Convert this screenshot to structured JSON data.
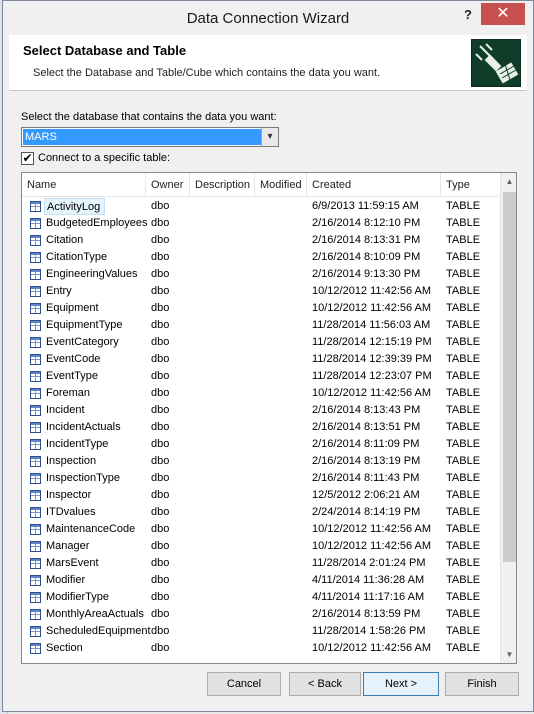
{
  "window": {
    "title": "Data Connection Wizard",
    "help_label": "?",
    "close_label": "✕"
  },
  "header": {
    "title": "Select Database and Table",
    "subtitle": "Select the Database and Table/Cube which contains the data you want."
  },
  "database": {
    "label": "Select the database that contains the data you want:",
    "selected": "MARS",
    "arrow": "▾"
  },
  "connect_specific": {
    "checked": true,
    "check_glyph": "✔",
    "label": "Connect to a specific table:"
  },
  "table": {
    "columns": [
      "Name",
      "Owner",
      "Description",
      "Modified",
      "Created",
      "Type"
    ],
    "rows": [
      {
        "name": "ActivityLog",
        "owner": "dbo",
        "description": "",
        "modified": "",
        "created": "6/9/2013 11:59:15 AM",
        "type": "TABLE",
        "selected": true
      },
      {
        "name": "BudgetedEmployees",
        "owner": "dbo",
        "description": "",
        "modified": "",
        "created": "2/16/2014 8:12:10 PM",
        "type": "TABLE"
      },
      {
        "name": "Citation",
        "owner": "dbo",
        "description": "",
        "modified": "",
        "created": "2/16/2014 8:13:31 PM",
        "type": "TABLE"
      },
      {
        "name": "CitationType",
        "owner": "dbo",
        "description": "",
        "modified": "",
        "created": "2/16/2014 8:10:09 PM",
        "type": "TABLE"
      },
      {
        "name": "EngineeringValues",
        "owner": "dbo",
        "description": "",
        "modified": "",
        "created": "2/16/2014 9:13:30 PM",
        "type": "TABLE"
      },
      {
        "name": "Entry",
        "owner": "dbo",
        "description": "",
        "modified": "",
        "created": "10/12/2012 11:42:56 AM",
        "type": "TABLE"
      },
      {
        "name": "Equipment",
        "owner": "dbo",
        "description": "",
        "modified": "",
        "created": "10/12/2012 11:42:56 AM",
        "type": "TABLE"
      },
      {
        "name": "EquipmentType",
        "owner": "dbo",
        "description": "",
        "modified": "",
        "created": "11/28/2014 11:56:03 AM",
        "type": "TABLE"
      },
      {
        "name": "EventCategory",
        "owner": "dbo",
        "description": "",
        "modified": "",
        "created": "11/28/2014 12:15:19 PM",
        "type": "TABLE"
      },
      {
        "name": "EventCode",
        "owner": "dbo",
        "description": "",
        "modified": "",
        "created": "11/28/2014 12:39:39 PM",
        "type": "TABLE"
      },
      {
        "name": "EventType",
        "owner": "dbo",
        "description": "",
        "modified": "",
        "created": "11/28/2014 12:23:07 PM",
        "type": "TABLE"
      },
      {
        "name": "Foreman",
        "owner": "dbo",
        "description": "",
        "modified": "",
        "created": "10/12/2012 11:42:56 AM",
        "type": "TABLE"
      },
      {
        "name": "Incident",
        "owner": "dbo",
        "description": "",
        "modified": "",
        "created": "2/16/2014 8:13:43 PM",
        "type": "TABLE"
      },
      {
        "name": "IncidentActuals",
        "owner": "dbo",
        "description": "",
        "modified": "",
        "created": "2/16/2014 8:13:51 PM",
        "type": "TABLE"
      },
      {
        "name": "IncidentType",
        "owner": "dbo",
        "description": "",
        "modified": "",
        "created": "2/16/2014 8:11:09 PM",
        "type": "TABLE"
      },
      {
        "name": "Inspection",
        "owner": "dbo",
        "description": "",
        "modified": "",
        "created": "2/16/2014 8:13:19 PM",
        "type": "TABLE"
      },
      {
        "name": "InspectionType",
        "owner": "dbo",
        "description": "",
        "modified": "",
        "created": "2/16/2014 8:11:43 PM",
        "type": "TABLE"
      },
      {
        "name": "Inspector",
        "owner": "dbo",
        "description": "",
        "modified": "",
        "created": "12/5/2012 2:06:21 AM",
        "type": "TABLE"
      },
      {
        "name": "ITDvalues",
        "owner": "dbo",
        "description": "",
        "modified": "",
        "created": "2/24/2014 8:14:19 PM",
        "type": "TABLE"
      },
      {
        "name": "MaintenanceCode",
        "owner": "dbo",
        "description": "",
        "modified": "",
        "created": "10/12/2012 11:42:56 AM",
        "type": "TABLE"
      },
      {
        "name": "Manager",
        "owner": "dbo",
        "description": "",
        "modified": "",
        "created": "10/12/2012 11:42:56 AM",
        "type": "TABLE"
      },
      {
        "name": "MarsEvent",
        "owner": "dbo",
        "description": "",
        "modified": "",
        "created": "11/28/2014 2:01:24 PM",
        "type": "TABLE"
      },
      {
        "name": "Modifier",
        "owner": "dbo",
        "description": "",
        "modified": "",
        "created": "4/11/2014 11:36:28 AM",
        "type": "TABLE"
      },
      {
        "name": "ModifierType",
        "owner": "dbo",
        "description": "",
        "modified": "",
        "created": "4/11/2014 11:17:16 AM",
        "type": "TABLE"
      },
      {
        "name": "MonthlyAreaActuals",
        "owner": "dbo",
        "description": "",
        "modified": "",
        "created": "2/16/2014 8:13:59 PM",
        "type": "TABLE"
      },
      {
        "name": "ScheduledEquipment",
        "owner": "dbo",
        "description": "",
        "modified": "",
        "created": "11/28/2014 1:58:26 PM",
        "type": "TABLE"
      },
      {
        "name": "Section",
        "owner": "dbo",
        "description": "",
        "modified": "",
        "created": "10/12/2012 11:42:56 AM",
        "type": "TABLE"
      }
    ]
  },
  "buttons": {
    "cancel": "Cancel",
    "back": "< Back",
    "next": "Next >",
    "finish": "Finish"
  },
  "icons": {
    "table_row": "table-icon",
    "wizard_logo": "data-connection-plug-icon"
  },
  "colors": {
    "selection_blue": "#3399ff",
    "close_red": "#c75050",
    "logo_green": "#0f3d2a"
  }
}
